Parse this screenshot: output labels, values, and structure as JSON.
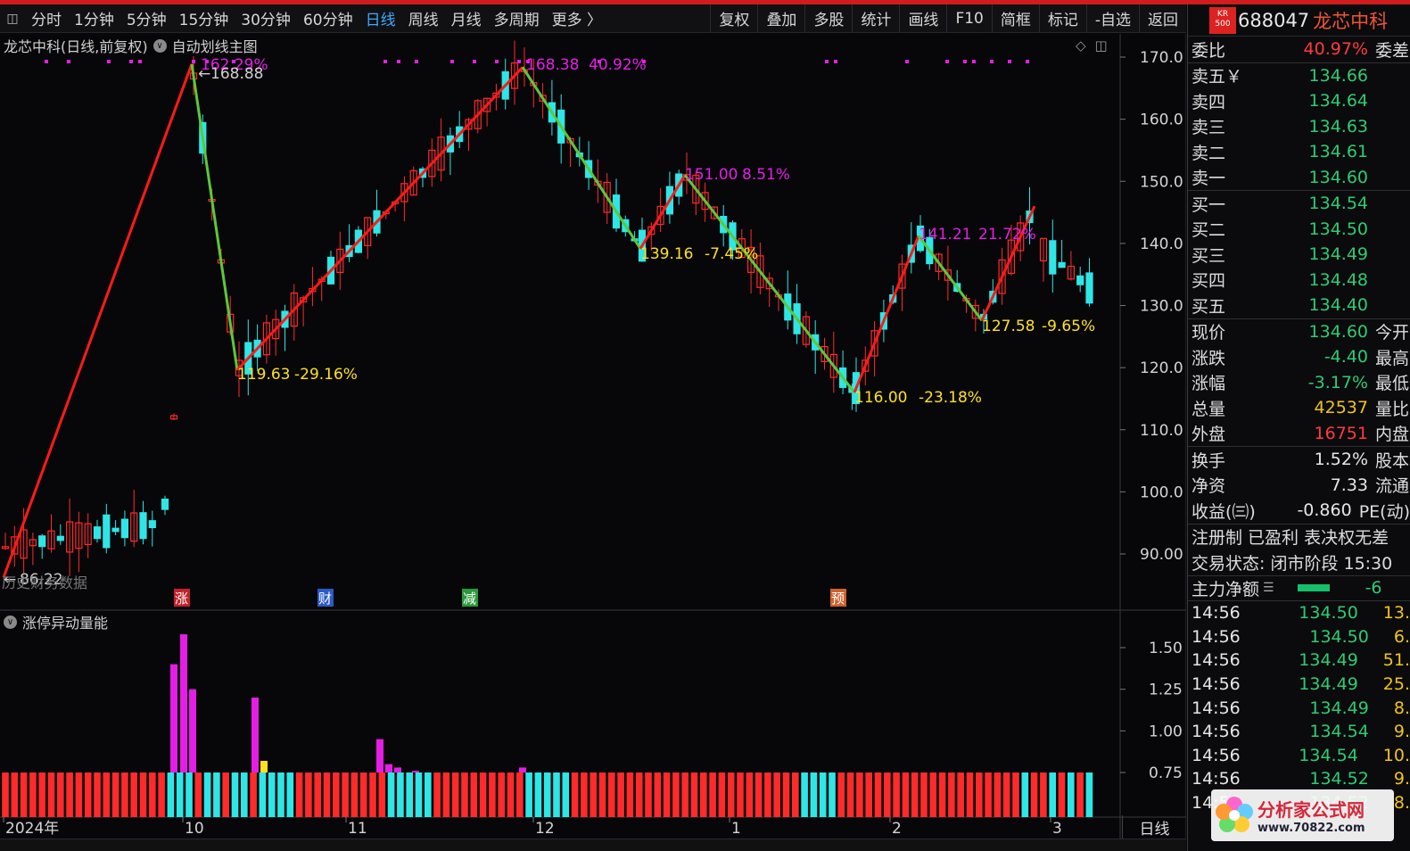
{
  "toolbar": {
    "periods": [
      "分时",
      "1分钟",
      "5分钟",
      "15分钟",
      "30分钟",
      "60分钟",
      "日线",
      "周线",
      "月线",
      "多周期",
      "更多 〉"
    ],
    "active_period": "日线",
    "right_buttons": [
      "复权",
      "叠加",
      "多股",
      "统计",
      "画线",
      "F10",
      "简框",
      "标记",
      "-自选",
      "返回"
    ]
  },
  "chart": {
    "title": "龙芯中科(日线,前复权)",
    "indicator_name": "自动划线主图",
    "indicator2_name": "涨停异动量能",
    "no_data_label": "历史财务数据",
    "period_label": "日线",
    "markers": [
      "涨",
      "财",
      "减",
      "预"
    ],
    "y_ticks": [
      "170.0",
      "160.0",
      "150.0",
      "140.0",
      "130.0",
      "120.0",
      "110.0",
      "100.0",
      "90.00"
    ],
    "ind_ticks": [
      "1.50",
      "1.25",
      "1.00",
      "0.75"
    ],
    "x_ticks": [
      "2024年",
      "10",
      "11",
      "12",
      "1",
      "2",
      "3"
    ],
    "annotations": [
      "162.29%",
      "168.88",
      "168.38",
      "40.92%",
      "119.63",
      "-29.16%",
      "151.00",
      "8.51%",
      "139.16",
      "-7.45%",
      "141.21",
      "21.72%",
      "127.58",
      "-9.65%",
      "116.00",
      "-23.18%",
      "86.22"
    ],
    "colors": {
      "up": "#ff2a2a",
      "down": "#2ee6e6",
      "rise_line": "#ff1a1a",
      "fall_line": "#5cc83a",
      "magenta": "#e51ee5",
      "yellow": "#ffe21a"
    }
  },
  "chart_data": {
    "type": "candlestick",
    "zigzag": [
      {
        "date": "2024-09-01",
        "price": 86.22,
        "label": ""
      },
      {
        "date": "2024-09-27",
        "price": 168.88,
        "label": "162.29%"
      },
      {
        "date": "2024-10-10",
        "price": 119.63,
        "label": "-29.16%"
      },
      {
        "date": "2024-12-04",
        "price": 168.38,
        "label": "40.92%"
      },
      {
        "date": "2024-12-18",
        "price": 139.16,
        "label": "-7.45%"
      },
      {
        "date": "2024-12-24",
        "price": 151.0,
        "label": "8.51%"
      },
      {
        "date": "2025-01-24",
        "price": 116.0,
        "label": "-23.18%"
      },
      {
        "date": "2025-02-11",
        "price": 141.21,
        "label": "21.72%"
      },
      {
        "date": "2025-02-21",
        "price": 127.58,
        "label": "-9.65%"
      },
      {
        "date": "2025-03-03",
        "price": 146.0,
        "label": ""
      }
    ],
    "ylim": [
      85,
      172
    ],
    "indicator_ylim": [
      0.5,
      1.65
    ],
    "indicator_spikes": [
      {
        "date": "2024-09-26",
        "value": 1.4,
        "color": "magenta"
      },
      {
        "date": "2024-09-27",
        "value": 1.58,
        "color": "magenta"
      },
      {
        "date": "2024-09-30",
        "value": 1.25,
        "color": "magenta"
      },
      {
        "date": "2024-10-08",
        "value": 1.2,
        "color": "magenta"
      },
      {
        "date": "2024-10-09",
        "value": 0.82,
        "color": "yellow"
      },
      {
        "date": "2024-11-06",
        "value": 0.95,
        "color": "magenta"
      }
    ]
  },
  "quote": {
    "code": "688047",
    "name": "龙芯中科",
    "badge": "KR\n500",
    "weibi_label": "委比",
    "weibi": "40.97%",
    "weicha_label": "委差",
    "asks": [
      {
        "label": "卖五￥",
        "price": "134.66"
      },
      {
        "label": "卖四",
        "price": "134.64"
      },
      {
        "label": "卖三",
        "price": "134.63"
      },
      {
        "label": "卖二",
        "price": "134.61"
      },
      {
        "label": "卖一",
        "price": "134.60"
      }
    ],
    "bids": [
      {
        "label": "买一",
        "price": "134.54"
      },
      {
        "label": "买二",
        "price": "134.50"
      },
      {
        "label": "买三",
        "price": "134.49"
      },
      {
        "label": "买四",
        "price": "134.48"
      },
      {
        "label": "买五",
        "price": "134.40"
      }
    ],
    "stats": [
      {
        "label": "现价",
        "value": "134.60",
        "ext": "今开",
        "cls": "grn"
      },
      {
        "label": "涨跌",
        "value": "-4.40",
        "ext": "最高",
        "cls": "grn"
      },
      {
        "label": "涨幅",
        "value": "-3.17%",
        "ext": "最低",
        "cls": "grn"
      },
      {
        "label": "总量",
        "value": "42537",
        "ext": "量比",
        "cls": "yel"
      },
      {
        "label": "外盘",
        "value": "16751",
        "ext": "内盘",
        "cls": "red"
      }
    ],
    "stats2": [
      {
        "label": "换手",
        "value": "1.52%",
        "ext": "股本",
        "cls": "wht"
      },
      {
        "label": "净资",
        "value": "7.33",
        "ext": "流通",
        "cls": "wht"
      },
      {
        "label": "收益(㈢)",
        "value": "-0.860",
        "ext": "PE(动)",
        "cls": "wht"
      }
    ],
    "reg_line": "注册制 已盈利 表决权无差",
    "trade_status": "交易状态: 闭市阶段 15:30",
    "main_flow_label": "主力净额",
    "main_flow_value": "-6",
    "ticks": [
      {
        "time": "14:56",
        "price": "134.50",
        "vol": "13."
      },
      {
        "time": "14:56",
        "price": "134.50",
        "vol": "6."
      },
      {
        "time": "14:56",
        "price": "134.49",
        "vol": "51."
      },
      {
        "time": "14:56",
        "price": "134.49",
        "vol": "25."
      },
      {
        "time": "14:56",
        "price": "134.49",
        "vol": "8."
      },
      {
        "time": "14:56",
        "price": "134.54",
        "vol": "9."
      },
      {
        "time": "14:56",
        "price": "134.54",
        "vol": "10."
      },
      {
        "time": "14:56",
        "price": "134.52",
        "vol": "9."
      },
      {
        "time": "14:56",
        "price": "134.52",
        "vol": "8."
      }
    ]
  },
  "watermark": {
    "name": "分析家公式网",
    "url": "www.70822.com"
  }
}
